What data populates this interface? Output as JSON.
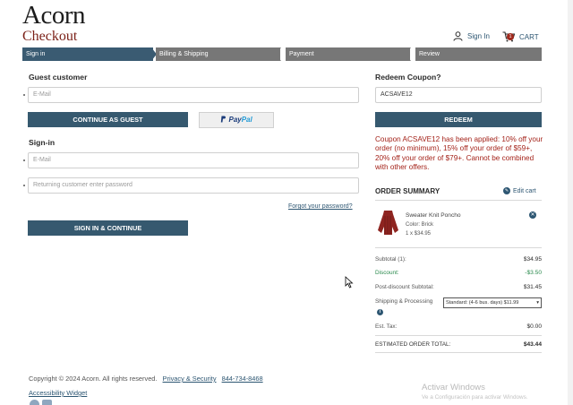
{
  "brand": {
    "logo": "Acorn",
    "page_title": "Checkout"
  },
  "header": {
    "signin_label": "Sign In",
    "cart_label": "CART",
    "cart_count": "1"
  },
  "steps": [
    "Sign in",
    "Billing & Shipping",
    "Payment",
    "Review"
  ],
  "guest": {
    "title": "Guest customer",
    "email_placeholder": "E-Mail",
    "continue_label": "CONTINUE AS GUEST",
    "paypal_pay": "Pay",
    "paypal_pal": "Pal"
  },
  "signin": {
    "title": "Sign-in",
    "email_placeholder": "E-Mail",
    "password_placeholder": "Returning customer enter password",
    "forgot_label": "Forgot your password?",
    "submit_label": "SIGN IN & CONTINUE"
  },
  "coupon": {
    "title": "Redeem Coupon?",
    "value": "ACSAVE12",
    "redeem_label": "REDEEM",
    "message": "Coupon ACSAVE12 has been applied: 10% off your order (no minimum), 15% off your order of $59+, 20% off your order of $79+. Cannot be combined with other offers."
  },
  "summary": {
    "title": "ORDER SUMMARY",
    "edit_label": "Edit cart",
    "product": {
      "name": "Sweater Knit Poncho",
      "color": "Color: Brick",
      "qty_price": "1 x $34.95",
      "color_hex": "#8e2420"
    },
    "rows": {
      "subtotal_label": "Subtotal (1):",
      "subtotal_value": "$34.95",
      "discount_label": "Discount:",
      "discount_value": "-$3.50",
      "post_label": "Post-discount Subtotal:",
      "post_value": "$31.45",
      "shipping_label": "Shipping & Processing",
      "shipping_value": "Standard: (4-6 bus. days) $11.99",
      "tax_label": "Est. Tax:",
      "tax_value": "$0.00",
      "total_label": "ESTIMATED ORDER TOTAL:",
      "total_value": "$43.44"
    }
  },
  "footer": {
    "copyright": "Copyright © 2024 Acorn. All rights reserved.",
    "privacy_label": "Privacy & Security",
    "phone": "844-734-8468",
    "accessibility_label": "Accessibility Widget"
  },
  "watermark": {
    "line1": "Activar Windows",
    "line2": "Ve a Configuración para activar Windows."
  },
  "colors": {
    "accent": "#36596f",
    "brand_red": "#7a1f16",
    "alert_red": "#a4231a",
    "discount_green": "#2a8a4d"
  }
}
